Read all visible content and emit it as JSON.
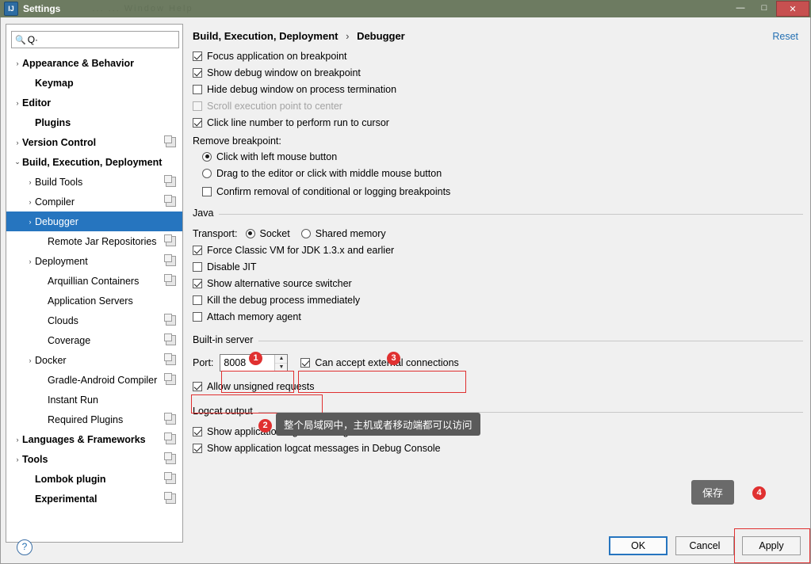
{
  "window": {
    "title": "Settings",
    "ghost_menu": "...  ...  Window  Help",
    "app_icon_letter": "IJ",
    "minimize": "—",
    "maximize": "□",
    "close": "✕"
  },
  "search": {
    "placeholder": "",
    "value": "Q·",
    "icon": "search-icon"
  },
  "tree": [
    {
      "label": "Appearance & Behavior",
      "arrow": "›",
      "bold": true,
      "indent": 0,
      "selected": false,
      "copy": false
    },
    {
      "label": "Keymap",
      "arrow": "",
      "bold": true,
      "indent": 1,
      "selected": false,
      "copy": false
    },
    {
      "label": "Editor",
      "arrow": "›",
      "bold": true,
      "indent": 0,
      "selected": false,
      "copy": false
    },
    {
      "label": "Plugins",
      "arrow": "",
      "bold": true,
      "indent": 1,
      "selected": false,
      "copy": false
    },
    {
      "label": "Version Control",
      "arrow": "›",
      "bold": true,
      "indent": 0,
      "selected": false,
      "copy": true
    },
    {
      "label": "Build, Execution, Deployment",
      "arrow": "⌄",
      "bold": true,
      "indent": 0,
      "selected": false,
      "copy": false
    },
    {
      "label": "Build Tools",
      "arrow": "›",
      "bold": false,
      "indent": 1,
      "selected": false,
      "copy": true
    },
    {
      "label": "Compiler",
      "arrow": "›",
      "bold": false,
      "indent": 1,
      "selected": false,
      "copy": true
    },
    {
      "label": "Debugger",
      "arrow": "›",
      "bold": false,
      "indent": 1,
      "selected": true,
      "copy": false
    },
    {
      "label": "Remote Jar Repositories",
      "arrow": "",
      "bold": false,
      "indent": 2,
      "selected": false,
      "copy": true
    },
    {
      "label": "Deployment",
      "arrow": "›",
      "bold": false,
      "indent": 1,
      "selected": false,
      "copy": true
    },
    {
      "label": "Arquillian Containers",
      "arrow": "",
      "bold": false,
      "indent": 2,
      "selected": false,
      "copy": true
    },
    {
      "label": "Application Servers",
      "arrow": "",
      "bold": false,
      "indent": 2,
      "selected": false,
      "copy": false
    },
    {
      "label": "Clouds",
      "arrow": "",
      "bold": false,
      "indent": 2,
      "selected": false,
      "copy": true
    },
    {
      "label": "Coverage",
      "arrow": "",
      "bold": false,
      "indent": 2,
      "selected": false,
      "copy": true
    },
    {
      "label": "Docker",
      "arrow": "›",
      "bold": false,
      "indent": 1,
      "selected": false,
      "copy": true
    },
    {
      "label": "Gradle-Android Compiler",
      "arrow": "",
      "bold": false,
      "indent": 2,
      "selected": false,
      "copy": true
    },
    {
      "label": "Instant Run",
      "arrow": "",
      "bold": false,
      "indent": 2,
      "selected": false,
      "copy": false
    },
    {
      "label": "Required Plugins",
      "arrow": "",
      "bold": false,
      "indent": 2,
      "selected": false,
      "copy": true
    },
    {
      "label": "Languages & Frameworks",
      "arrow": "›",
      "bold": true,
      "indent": 0,
      "selected": false,
      "copy": true
    },
    {
      "label": "Tools",
      "arrow": "›",
      "bold": true,
      "indent": 0,
      "selected": false,
      "copy": true
    },
    {
      "label": "Lombok plugin",
      "arrow": "",
      "bold": true,
      "indent": 1,
      "selected": false,
      "copy": true
    },
    {
      "label": "Experimental",
      "arrow": "",
      "bold": true,
      "indent": 1,
      "selected": false,
      "copy": true
    }
  ],
  "breadcrumb": {
    "parent": "Build, Execution, Deployment",
    "separator": "›",
    "current": "Debugger"
  },
  "reset_label": "Reset",
  "general": [
    {
      "label": "Focus application on breakpoint",
      "checked": true,
      "disabled": false
    },
    {
      "label": "Show debug window on breakpoint",
      "checked": true,
      "disabled": false
    },
    {
      "label": "Hide debug window on process termination",
      "checked": false,
      "disabled": false
    },
    {
      "label": "Scroll execution point to center",
      "checked": false,
      "disabled": true
    },
    {
      "label": "Click line number to perform run to cursor",
      "checked": true,
      "disabled": false
    }
  ],
  "remove_breakpoint": {
    "title": "Remove breakpoint:",
    "options": [
      {
        "label": "Click with left mouse button",
        "selected": true
      },
      {
        "label": "Drag to the editor or click with middle mouse button",
        "selected": false
      }
    ],
    "confirm": {
      "label": "Confirm removal of conditional or logging breakpoints",
      "checked": false
    }
  },
  "java": {
    "group_label": "Java",
    "transport_label": "Transport:",
    "transport_options": [
      {
        "label": "Socket",
        "selected": true
      },
      {
        "label": "Shared memory",
        "selected": false
      }
    ],
    "checkboxes": [
      {
        "label": "Force Classic VM for JDK 1.3.x and earlier",
        "checked": true
      },
      {
        "label": "Disable JIT",
        "checked": false
      },
      {
        "label": "Show alternative source switcher",
        "checked": true
      },
      {
        "label": "Kill the debug process immediately",
        "checked": false
      },
      {
        "label": "Attach memory agent",
        "checked": false
      }
    ]
  },
  "builtin_server": {
    "group_label": "Built-in server",
    "port_label": "Port:",
    "port_value": "8008",
    "accept_external": {
      "label": "Can accept external connections",
      "checked": true
    },
    "allow_unsigned": {
      "label": "Allow unsigned requests",
      "checked": true
    }
  },
  "logcat": {
    "group_label": "Logcat output",
    "checkboxes": [
      {
        "label": "Show application logcat messages in Run Console",
        "checked": true
      },
      {
        "label": "Show application logcat messages in Debug Console",
        "checked": true
      }
    ]
  },
  "annotations": {
    "badge_1": "1",
    "badge_2": "2",
    "badge_3": "3",
    "badge_4": "4",
    "tooltip": "整个局域网中，主机或者移动端都可以访问",
    "save_label": "保存",
    "accent_color": "#e03030"
  },
  "buttons": {
    "ok": "OK",
    "cancel": "Cancel",
    "apply": "Apply",
    "help": "?"
  }
}
